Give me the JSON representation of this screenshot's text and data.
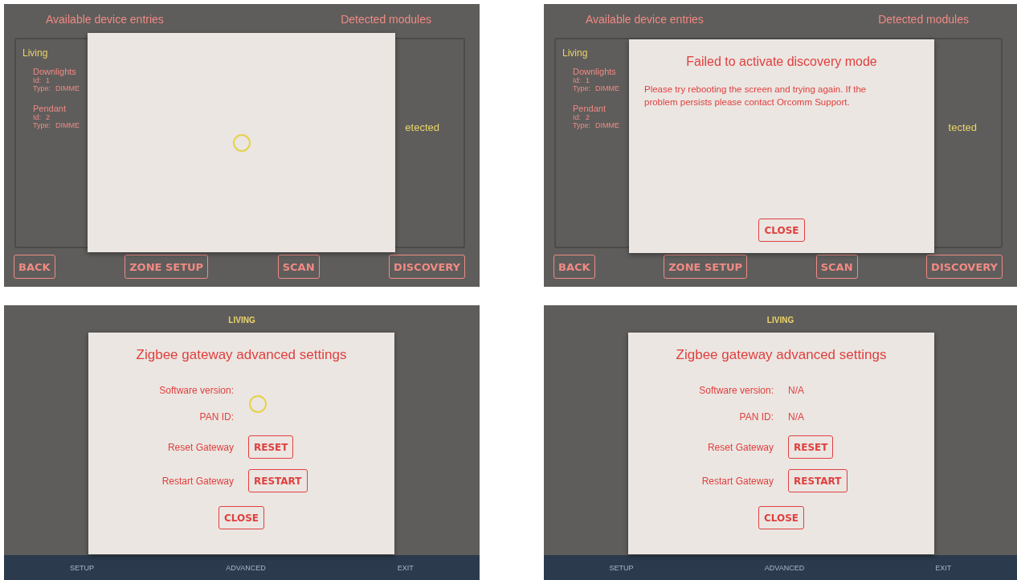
{
  "screens": [
    {
      "kind": "devices",
      "headers": [
        "Available device entries",
        "Detected modules"
      ],
      "zone": "Living",
      "devices": [
        {
          "name": "Downlights",
          "id_label": "Id:",
          "id": "1",
          "type_label": "Type:",
          "type": "DIMME"
        },
        {
          "name": "Pendant",
          "id_label": "Id:",
          "id": "2",
          "type_label": "Type:",
          "type": "DIMME"
        }
      ],
      "detected_text": "etected",
      "buttons": [
        "BACK",
        "ZONE SETUP",
        "SCAN",
        "DISCOVERY"
      ],
      "dialog": {
        "kind": "loading"
      }
    },
    {
      "kind": "devices",
      "headers": [
        "Available device entries",
        "Detected modules"
      ],
      "zone": "Living",
      "devices": [
        {
          "name": "Downlights",
          "id_label": "Id:",
          "id": "1",
          "type_label": "Type:",
          "type": "DIMME"
        },
        {
          "name": "Pendant",
          "id_label": "Id:",
          "id": "2",
          "type_label": "Type:",
          "type": "DIMME"
        }
      ],
      "detected_text": "tected",
      "buttons": [
        "BACK",
        "ZONE SETUP",
        "SCAN",
        "DISCOVERY"
      ],
      "dialog": {
        "kind": "message",
        "title": "Failed to activate discovery mode",
        "message": "Please try rebooting the screen and trying again. If the problem persists please contact Orcomm Support.",
        "button": "CLOSE"
      }
    },
    {
      "kind": "settings",
      "header": "LIVING",
      "nav": [
        "SETUP",
        "ADVANCED",
        "EXIT"
      ],
      "dialog": {
        "kind": "settings",
        "title": "Zigbee gateway advanced settings",
        "loading": true,
        "info": [
          {
            "label": "Software version:"
          },
          {
            "label": "PAN ID:"
          }
        ],
        "actions": [
          {
            "label": "Reset Gateway",
            "button": "RESET"
          },
          {
            "label": "Restart Gateway",
            "button": "RESTART"
          }
        ],
        "button": "CLOSE"
      }
    },
    {
      "kind": "settings",
      "header": "LIVING",
      "nav": [
        "SETUP",
        "ADVANCED",
        "EXIT"
      ],
      "dialog": {
        "kind": "settings",
        "title": "Zigbee gateway advanced settings",
        "loading": false,
        "info": [
          {
            "label": "Software version:",
            "value": "N/A"
          },
          {
            "label": "PAN ID:",
            "value": "N/A"
          }
        ],
        "actions": [
          {
            "label": "Reset Gateway",
            "button": "RESET"
          },
          {
            "label": "Restart Gateway",
            "button": "RESTART"
          }
        ],
        "button": "CLOSE"
      }
    }
  ]
}
